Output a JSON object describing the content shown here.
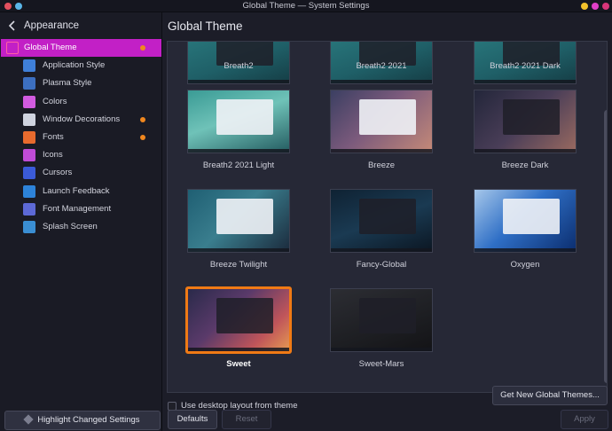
{
  "window": {
    "title": "Global Theme — System Settings",
    "left_dot_colors": [
      "#e2505f",
      "#5ab6e8"
    ],
    "right_dot_colors": [
      "#f2c12b",
      "#e03fc7",
      "#d9367a"
    ]
  },
  "sidebar": {
    "header": "Appearance",
    "items": [
      {
        "label": "Global Theme",
        "active": true,
        "changed": true,
        "icon": "paintbrush-icon",
        "color": "#ff5fa2"
      },
      {
        "label": "Application Style",
        "active": false,
        "changed": false,
        "icon": "app-style-icon",
        "color": "#3f7fd8"
      },
      {
        "label": "Plasma Style",
        "active": false,
        "changed": false,
        "icon": "plasma-style-icon",
        "color": "#3c6fc0"
      },
      {
        "label": "Colors",
        "active": false,
        "changed": false,
        "icon": "colors-icon",
        "color": "#d25be0"
      },
      {
        "label": "Window Decorations",
        "active": false,
        "changed": true,
        "icon": "window-decorations-icon",
        "color": "#cfd3df"
      },
      {
        "label": "Fonts",
        "active": false,
        "changed": true,
        "icon": "fonts-icon",
        "color": "#e86b2e"
      },
      {
        "label": "Icons",
        "active": false,
        "changed": false,
        "icon": "icons-icon",
        "color": "#c04cd6"
      },
      {
        "label": "Cursors",
        "active": false,
        "changed": false,
        "icon": "cursor-icon",
        "color": "#3b5bd8"
      },
      {
        "label": "Launch Feedback",
        "active": false,
        "changed": false,
        "icon": "launch-feedback-icon",
        "color": "#2d83d9"
      },
      {
        "label": "Font Management",
        "active": false,
        "changed": false,
        "icon": "font-management-icon",
        "color": "#5d69d6"
      },
      {
        "label": "Splash Screen",
        "active": false,
        "changed": false,
        "icon": "splash-screen-icon",
        "color": "#3a8ed3"
      }
    ],
    "highlight_button": "Highlight Changed Settings"
  },
  "main": {
    "title": "Global Theme",
    "themes": [
      {
        "name": "Breath2",
        "style": "teal",
        "selected": false
      },
      {
        "name": "Breath2 2021",
        "style": "teal",
        "selected": false
      },
      {
        "name": "Breath2 2021 Dark",
        "style": "teal",
        "selected": false
      },
      {
        "name": "Breath2 2021 Light",
        "style": "teal-light",
        "selected": false
      },
      {
        "name": "Breeze",
        "style": "breeze",
        "selected": false
      },
      {
        "name": "Breeze Dark",
        "style": "breeze-dark",
        "selected": false
      },
      {
        "name": "Breeze Twilight",
        "style": "twilight",
        "selected": false
      },
      {
        "name": "Fancy-Global",
        "style": "fancy",
        "selected": false
      },
      {
        "name": "Oxygen",
        "style": "oxygen",
        "selected": false
      },
      {
        "name": "Sweet",
        "style": "sweet",
        "selected": true
      },
      {
        "name": "Sweet-Mars",
        "style": "mars",
        "selected": false
      }
    ],
    "checkbox_label": "Use desktop layout from theme",
    "get_new_button": "Get New Global Themes...",
    "defaults_button": "Defaults",
    "reset_button": "Reset",
    "apply_button": "Apply"
  },
  "colors": {
    "accent": "#c220c6",
    "changed_dot": "#f0871e",
    "selection_border": "#f07a15"
  }
}
